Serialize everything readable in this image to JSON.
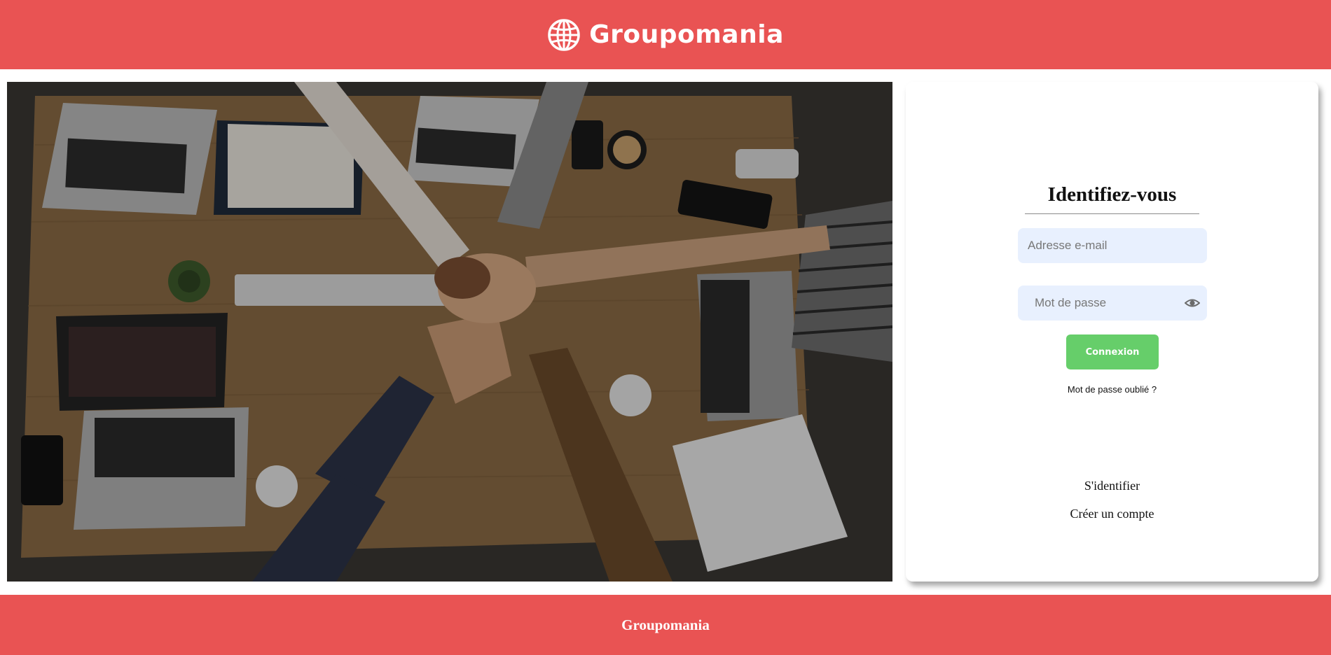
{
  "header": {
    "brand_name": "Groupomania",
    "logo_icon": "globe-icon"
  },
  "hero_image": {
    "description_icon": "team-hands-photo"
  },
  "login_card": {
    "title": "Identifiez-vous",
    "email": {
      "placeholder": "Adresse e-mail",
      "value": ""
    },
    "password": {
      "placeholder": "Mot de passe",
      "value": "",
      "toggle_icon": "eye-icon"
    },
    "submit_label": "Connexion",
    "forgot_label": "Mot de passe oublié ?",
    "nav_login_label": "S'identifier",
    "nav_signup_label": "Créer un compte"
  },
  "footer": {
    "text": "Groupomania"
  },
  "colors": {
    "brand_red": "#e95353",
    "button_green": "#66ce6a",
    "input_background": "#e8f0fe"
  }
}
